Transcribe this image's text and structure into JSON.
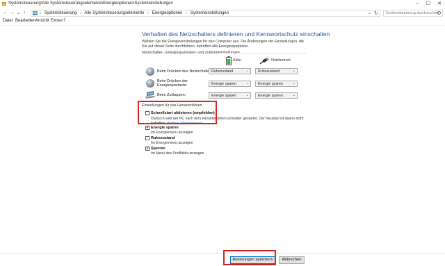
{
  "window": {
    "title": "Systemsteuerung\\Alle Systemsteuerungselemente\\Energieoptionen\\Systemeinstellungen",
    "controls": [
      "–",
      "☐",
      "✕"
    ]
  },
  "address": {
    "back": "←",
    "forward": "→",
    "recent": "⌄",
    "up": "↑",
    "breadcrumbs": [
      "Systemsteuerung",
      "Alle Systemsteuerungselemente",
      "Energieoptionen",
      "Systemeinstellungen"
    ],
    "separator": "›",
    "dropdown": "⌄",
    "refresh": "↻",
    "search_placeholder": "Systemsteuerung durchsuchen"
  },
  "menu": [
    "Datei",
    "Bearbeiten",
    "Ansicht",
    "Extras",
    "?"
  ],
  "main": {
    "heading": "Verhalten des Netzschalters definieren und Kennwortschutz einschalten",
    "intro": "Wählen Sie die Energieeinstellungen für den Computer aus. Die Änderungen der Einstellungen, die Sie auf dieser Seite durchführen, betreffen alle Energiesparpläne.",
    "section1": "Netzschalter-, Energiespartasten- und Zuklappeinstellungen",
    "col_battery": "Akku",
    "col_plugged": "Netzbetrieb",
    "rows": [
      {
        "label": "Beim Drücken des Netzschalters:",
        "battery": "Ruhezustand",
        "plugged": "Ruhezustand"
      },
      {
        "label": "Beim Drücken der Energiespartaste:",
        "label1": "Beim Drücken der",
        "label2": "Energiespartaste:",
        "battery": "Energie sparen",
        "plugged": "Energie sparen"
      },
      {
        "label": "Beim Zuklappen:",
        "battery": "Energie sparen",
        "plugged": "Energie sparen"
      }
    ],
    "section2": "Einstellungen für das Herunterfahren",
    "options": [
      {
        "label": "Schnellstart aktivieren (empfohlen)",
        "checked": false,
        "desc1": "Dadurch wird der PC nach dem Herunterfahren schneller gestartet. Der Neustart ist davon nicht",
        "desc2_prefix": "betroffen. ",
        "desc2_link": "Weitere Informationen"
      },
      {
        "label": "Energie sparen",
        "checked": true,
        "desc": "Im Energiemenü anzeigen"
      },
      {
        "label": "Ruhezustand",
        "checked": false,
        "desc": "Im Energiemenü anzeigen"
      },
      {
        "label": "Sperren",
        "checked": true,
        "desc": "Im Menü des Profilbilds anzeigen"
      }
    ],
    "check_mark": "✓",
    "arrow": "⌄"
  },
  "footer": {
    "save": "Änderungen speichern",
    "cancel": "Abbrechen"
  },
  "colors": {
    "heading": "#2b5797",
    "highlight": "#d9231c",
    "link": "#2b6cc4"
  }
}
